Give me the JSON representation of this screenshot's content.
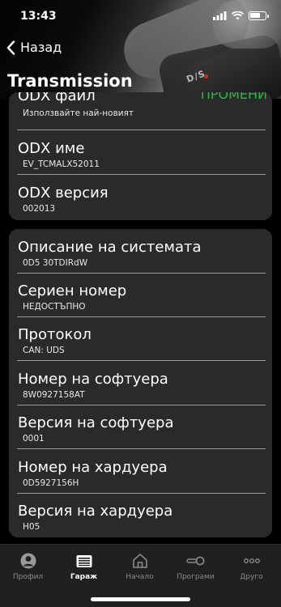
{
  "status_bar": {
    "time": "13:43",
    "battery_level": 0.7
  },
  "nav": {
    "back_label": "Назад",
    "title": "Transmission"
  },
  "odx_card": {
    "rows": [
      {
        "label": "ODX файл",
        "value": "Използвайте най-новият",
        "action": "ПРОМЕНИ"
      },
      {
        "label": "ODX име",
        "value": "EV_TCMALX52011"
      },
      {
        "label": "ODX версия",
        "value": "002013"
      }
    ]
  },
  "system_card": {
    "rows": [
      {
        "label": "Описание на системата",
        "value": "0D5 30TDIRdW"
      },
      {
        "label": "Сериен номер",
        "value": "НЕДОСТЪПНО"
      },
      {
        "label": "Протокол",
        "value": "CAN: UDS"
      },
      {
        "label": "Номер на софтуера",
        "value": "8W0927158AT"
      },
      {
        "label": "Версия на софтуера",
        "value": "0001"
      },
      {
        "label": "Номер на хардуера",
        "value": "0D5927156H"
      },
      {
        "label": "Версия на хардуера",
        "value": "H05"
      }
    ]
  },
  "tabbar": {
    "tabs": [
      {
        "label": "Профил",
        "icon": "person-icon"
      },
      {
        "label": "Гараж",
        "icon": "garage-icon",
        "active": true
      },
      {
        "label": "Начало",
        "icon": "home-icon"
      },
      {
        "label": "Програми",
        "icon": "toggle-icon"
      },
      {
        "label": "Друго",
        "icon": "more-icon"
      }
    ]
  },
  "colors": {
    "accent_green": "#2fb54a",
    "card_bg": "#2a2a2a",
    "tabbar_bg": "#202020"
  }
}
